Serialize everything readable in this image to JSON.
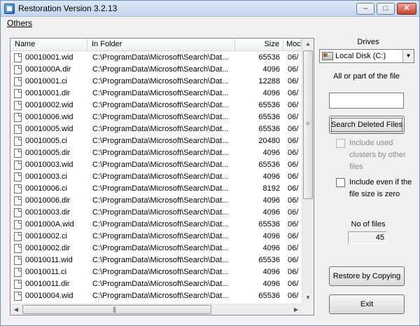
{
  "window": {
    "title": "Restoration Version 3.2.13"
  },
  "titlebar_buttons": {
    "minimize": "–",
    "maximize": "□",
    "close": "✕"
  },
  "menu": {
    "others": "Others"
  },
  "list": {
    "columns": {
      "name": "Name",
      "folder": "In Folder",
      "size": "Size",
      "modified": "Moc"
    },
    "rows": [
      {
        "name": "00010001.wid",
        "folder": "C:\\ProgramData\\Microsoft\\Search\\Dat...",
        "size": "65536",
        "modified": "06/"
      },
      {
        "name": "0001000A.dir",
        "folder": "C:\\ProgramData\\Microsoft\\Search\\Dat...",
        "size": "4096",
        "modified": "06/"
      },
      {
        "name": "00010001.ci",
        "folder": "C:\\ProgramData\\Microsoft\\Search\\Dat...",
        "size": "12288",
        "modified": "06/"
      },
      {
        "name": "00010001.dir",
        "folder": "C:\\ProgramData\\Microsoft\\Search\\Dat...",
        "size": "4096",
        "modified": "06/"
      },
      {
        "name": "00010002.wid",
        "folder": "C:\\ProgramData\\Microsoft\\Search\\Dat...",
        "size": "65536",
        "modified": "06/"
      },
      {
        "name": "00010006.wid",
        "folder": "C:\\ProgramData\\Microsoft\\Search\\Dat...",
        "size": "65536",
        "modified": "06/"
      },
      {
        "name": "00010005.wid",
        "folder": "C:\\ProgramData\\Microsoft\\Search\\Dat...",
        "size": "65536",
        "modified": "06/"
      },
      {
        "name": "00010005.ci",
        "folder": "C:\\ProgramData\\Microsoft\\Search\\Dat...",
        "size": "20480",
        "modified": "06/"
      },
      {
        "name": "00010005.dir",
        "folder": "C:\\ProgramData\\Microsoft\\Search\\Dat...",
        "size": "4096",
        "modified": "06/"
      },
      {
        "name": "00010003.wid",
        "folder": "C:\\ProgramData\\Microsoft\\Search\\Dat...",
        "size": "65536",
        "modified": "06/"
      },
      {
        "name": "00010003.ci",
        "folder": "C:\\ProgramData\\Microsoft\\Search\\Dat...",
        "size": "4096",
        "modified": "06/"
      },
      {
        "name": "00010006.ci",
        "folder": "C:\\ProgramData\\Microsoft\\Search\\Dat...",
        "size": "8192",
        "modified": "06/"
      },
      {
        "name": "00010006.dir",
        "folder": "C:\\ProgramData\\Microsoft\\Search\\Dat...",
        "size": "4096",
        "modified": "06/"
      },
      {
        "name": "00010003.dir",
        "folder": "C:\\ProgramData\\Microsoft\\Search\\Dat...",
        "size": "4096",
        "modified": "06/"
      },
      {
        "name": "0001000A.wid",
        "folder": "C:\\ProgramData\\Microsoft\\Search\\Dat...",
        "size": "65536",
        "modified": "06/"
      },
      {
        "name": "00010002.ci",
        "folder": "C:\\ProgramData\\Microsoft\\Search\\Dat...",
        "size": "4096",
        "modified": "06/"
      },
      {
        "name": "00010002.dir",
        "folder": "C:\\ProgramData\\Microsoft\\Search\\Dat...",
        "size": "4096",
        "modified": "06/"
      },
      {
        "name": "00010011.wid",
        "folder": "C:\\ProgramData\\Microsoft\\Search\\Dat...",
        "size": "65536",
        "modified": "06/"
      },
      {
        "name": "00010011.ci",
        "folder": "C:\\ProgramData\\Microsoft\\Search\\Dat...",
        "size": "4096",
        "modified": "06/"
      },
      {
        "name": "00010011.dir",
        "folder": "C:\\ProgramData\\Microsoft\\Search\\Dat...",
        "size": "4096",
        "modified": "06/"
      },
      {
        "name": "00010004.wid",
        "folder": "C:\\ProgramData\\Microsoft\\Search\\Dat...",
        "size": "65536",
        "modified": "06/"
      }
    ]
  },
  "scroll": {
    "up": "▲",
    "down": "▼",
    "left": "◀",
    "right": "▶",
    "vgrip": "≡",
    "hgrip": "|||"
  },
  "panel": {
    "drives_label": "Drives",
    "drive_selected": "Local Disk (C:)",
    "drive_arrow": "▼",
    "file_label": "All or part of the file",
    "file_value": "",
    "search_button": "Search Deleted Files",
    "include_used": "Include used clusters by other files",
    "include_zero": "Include even if the file size is zero",
    "nfiles_label": "No of files",
    "nfiles_value": "45",
    "restore_button": "Restore by Copying",
    "exit_button": "Exit"
  }
}
